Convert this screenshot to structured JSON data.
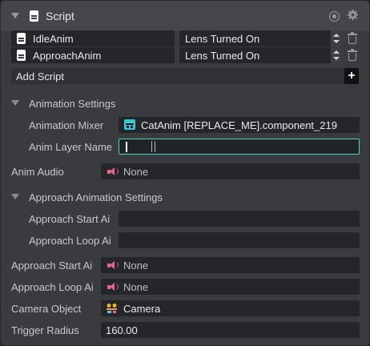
{
  "header": {
    "title": "Script"
  },
  "scripts": [
    {
      "name": "IdleAnim",
      "event": "Lens Turned On"
    },
    {
      "name": "ApproachAnim",
      "event": "Lens Turned On"
    }
  ],
  "add_script_label": "Add Script",
  "add_glyph": "+",
  "animation_settings": {
    "title": "Animation Settings",
    "mixer_label": "Animation Mixer",
    "mixer_value": "CatAnim [REPLACE_ME].component_219",
    "layer_label": "Anim Layer Name",
    "layer_value": ""
  },
  "anim_audio": {
    "label": "Anim Audio",
    "value": "None"
  },
  "approach_settings": {
    "title": "Approach Animation Settings",
    "start_label": "Approach Start Ai",
    "start_value": "",
    "loop_label": "Approach Loop Ai",
    "loop_value": ""
  },
  "approach_start_audio": {
    "label": "Approach Start Ai",
    "value": "None"
  },
  "approach_loop_audio": {
    "label": "Approach Loop Ai",
    "value": "None"
  },
  "camera": {
    "label": "Camera Object",
    "value": "Camera"
  },
  "trigger": {
    "label": "Trigger Radius",
    "value": "160.00"
  },
  "colors": {
    "accent_focus": "#4fd1c5",
    "audio_icon": "#e06a8a",
    "panel": "#3a3b3f",
    "field": "#25262a"
  }
}
